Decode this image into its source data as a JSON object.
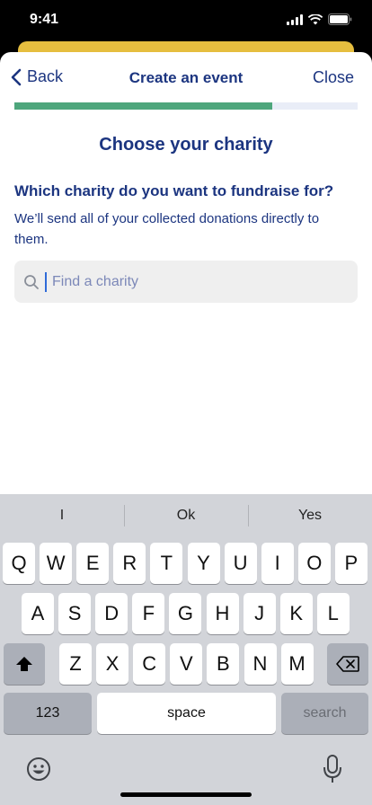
{
  "status": {
    "time": "9:41"
  },
  "nav": {
    "back_label": "Back",
    "title": "Create an event",
    "close_label": "Close"
  },
  "progress": {
    "fraction": 0.75
  },
  "page": {
    "heading": "Choose your charity",
    "question": "Which charity do you want to fundraise for?",
    "description": "We’ll send all of your collected donations directly to them."
  },
  "search": {
    "placeholder": "Find a charity",
    "value": ""
  },
  "keyboard": {
    "suggestions": [
      "I",
      "Ok",
      "Yes"
    ],
    "row1": [
      "Q",
      "W",
      "E",
      "R",
      "T",
      "Y",
      "U",
      "I",
      "O",
      "P"
    ],
    "row2": [
      "A",
      "S",
      "D",
      "F",
      "G",
      "H",
      "J",
      "K",
      "L"
    ],
    "row3": [
      "Z",
      "X",
      "C",
      "V",
      "B",
      "N",
      "M"
    ],
    "numbers_label": "123",
    "space_label": "space",
    "search_label": "search"
  },
  "colors": {
    "brand_navy": "#1c3580",
    "progress_green": "#4ea67c",
    "behind_sheet_yellow": "#e6be3f"
  }
}
